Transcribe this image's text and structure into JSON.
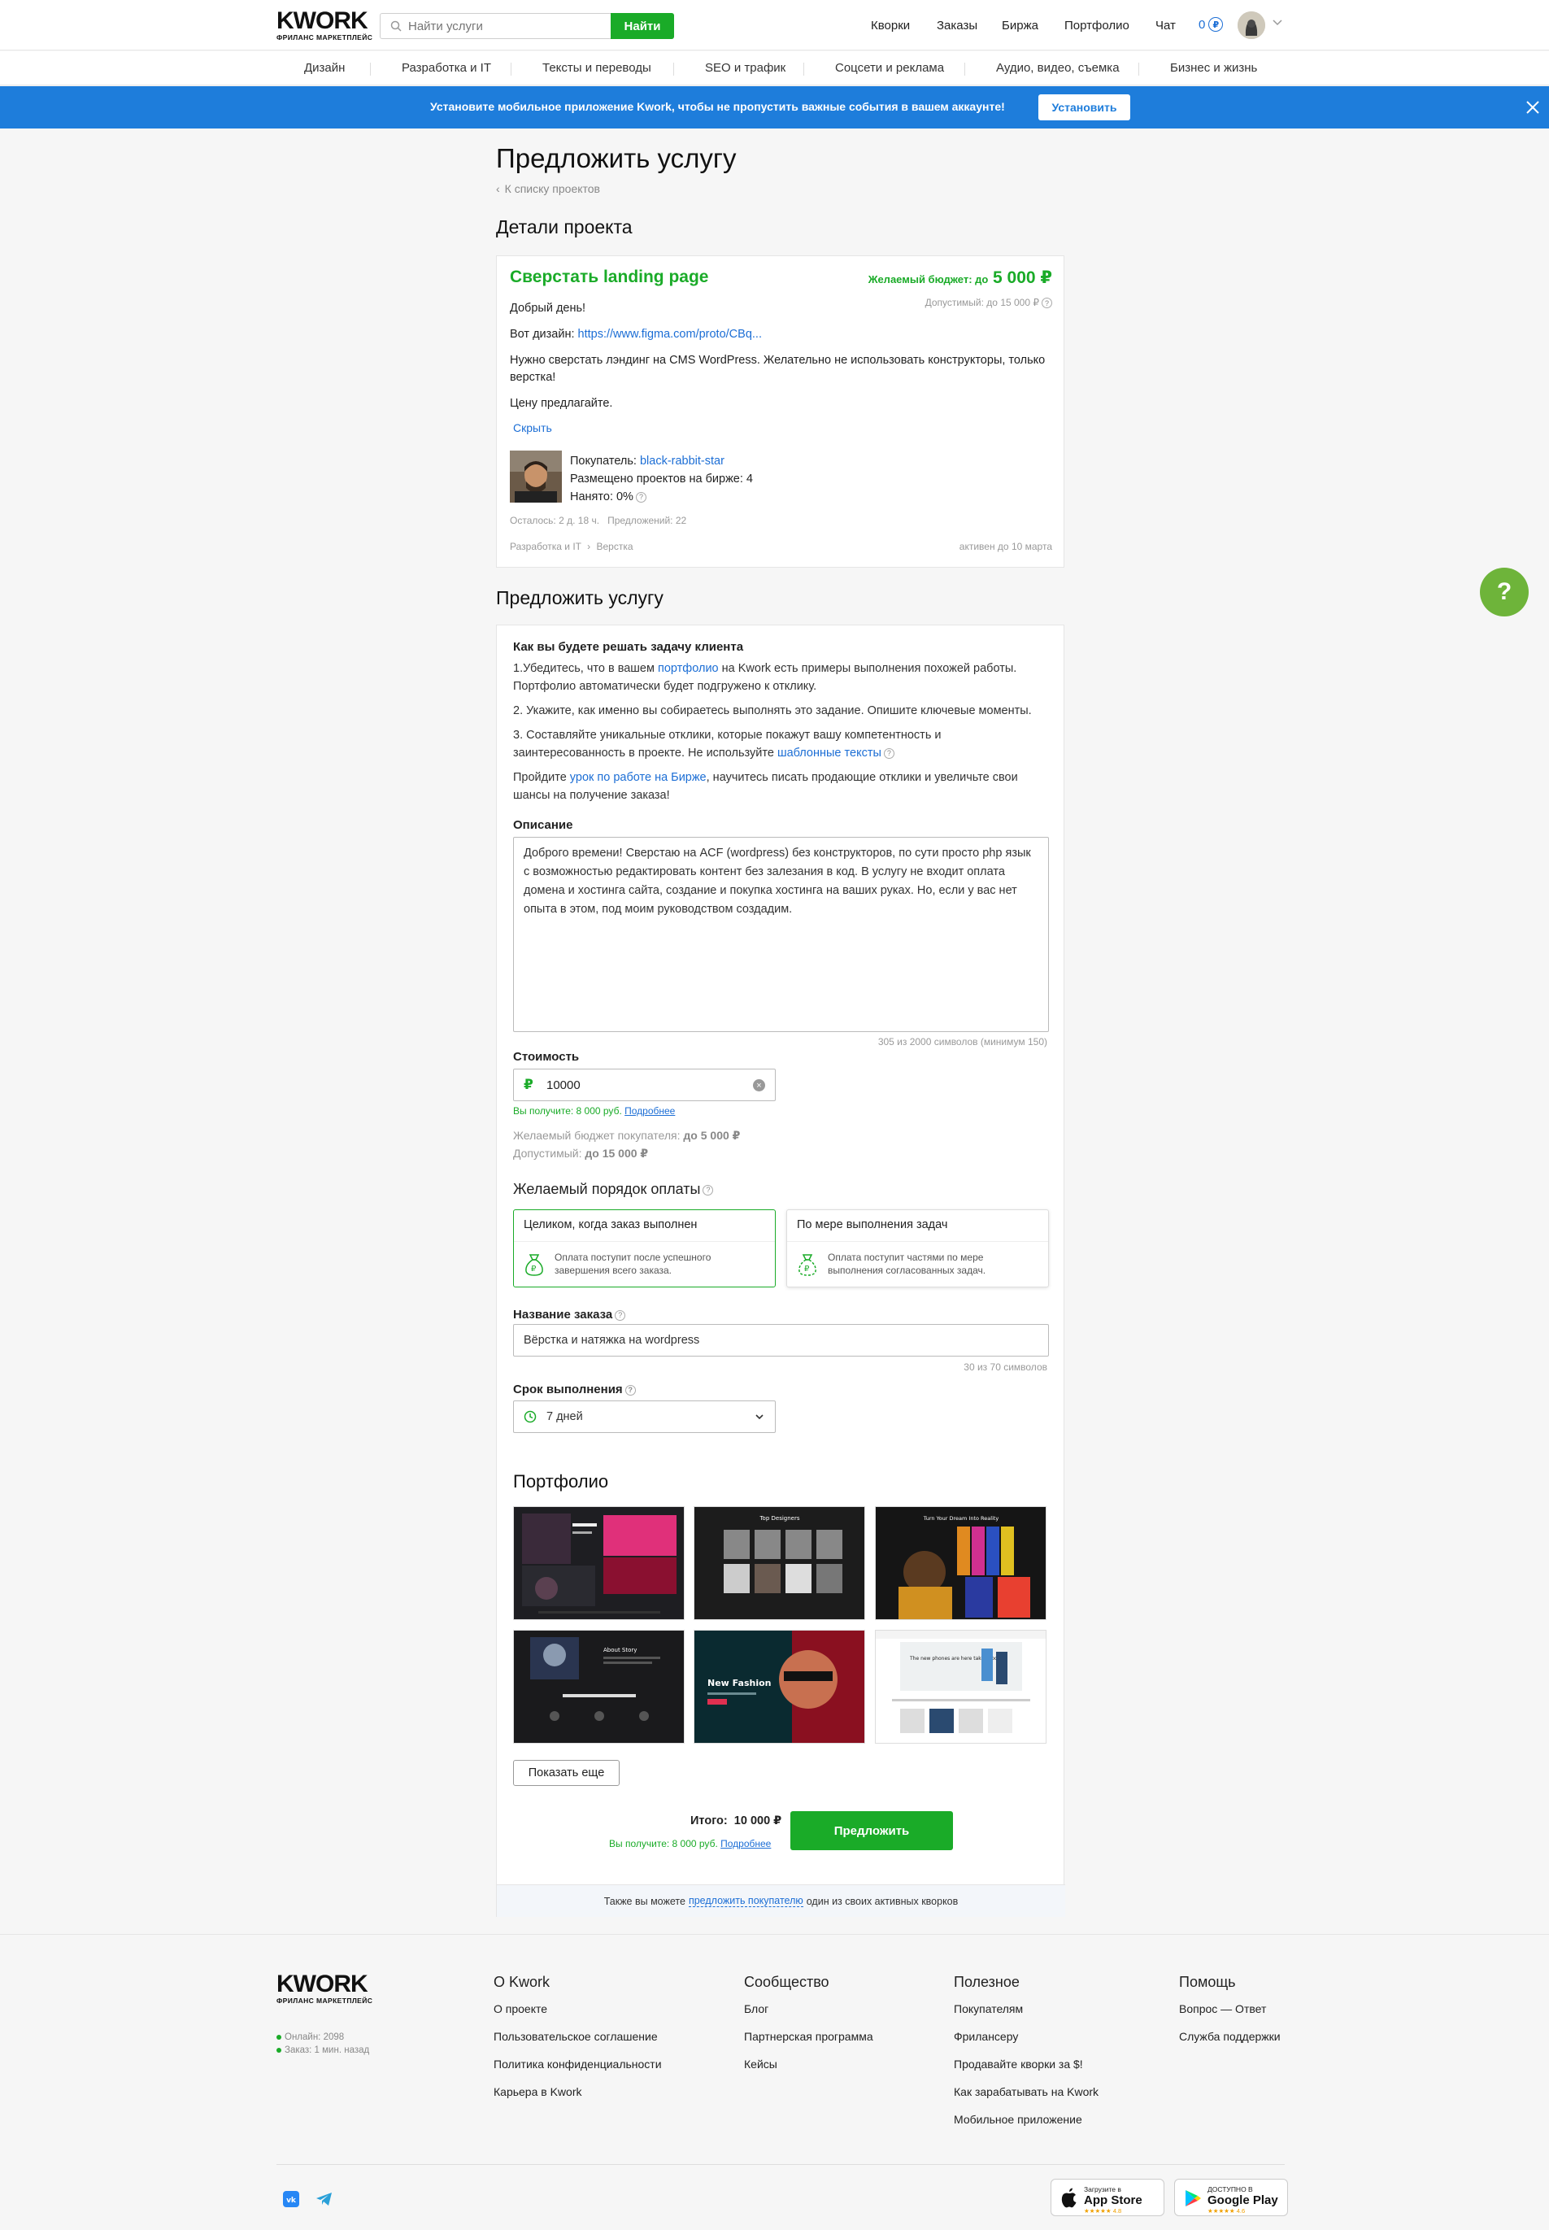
{
  "header": {
    "logo": "KWORK",
    "logo_sub": "ФРИЛАНС МАРКЕТПЛЕЙС",
    "search_placeholder": "Найти услуги",
    "search_btn": "Найти",
    "nav": [
      "Кворки",
      "Заказы",
      "Биржа",
      "Портфолио",
      "Чат"
    ],
    "balance": "0",
    "balance_icon": "₽"
  },
  "categories": [
    "Дизайн",
    "Разработка и IT",
    "Тексты и переводы",
    "SEO и трафик",
    "Соцсети и реклама",
    "Аудио, видео, съемка",
    "Бизнес и жизнь"
  ],
  "banner": {
    "text": "Установите мобильное приложение Kwork, чтобы не пропустить важные события в вашем аккаунте!",
    "button": "Установить"
  },
  "page": {
    "title": "Предложить услугу",
    "back": "К списку проектов",
    "details_heading": "Детали проекта",
    "offer_heading": "Предложить услугу"
  },
  "project": {
    "title": "Сверстать landing page",
    "budget_label": "Желаемый бюджет: до",
    "budget_value": "5 000 ₽",
    "allowed": "Допустимый: до 15 000 ₽",
    "p1": "Добрый день!",
    "p2_prefix": "Вот дизайн:",
    "p2_link": "https://www.figma.com/proto/CBq...",
    "p3": "Нужно сверстать лэндинг на CMS WordPress. Желательно не использовать конструкторы, только верстка!",
    "p4": "Цену предлагайте.",
    "hide": "Скрыть",
    "buyer_label": "Покупатель:",
    "buyer_name": "black-rabbit-star",
    "posted": "Размещено проектов на бирже: 4",
    "hired": "Нанято: 0%",
    "left": "Осталось: 2 д. 18 ч.",
    "offers": "Предложений: 22",
    "cat1": "Разработка и IT",
    "cat2": "Верстка",
    "active": "активен до 10 марта"
  },
  "offer": {
    "how_title": "Как вы будете решать задачу клиента",
    "s1_a": "1.Убедитесь, что в вашем",
    "s1_link": "портфолио",
    "s1_b": "на Kwork есть примеры выполнения похожей работы. Портфолио автоматически будет подгружено к отклику.",
    "s2": "2. Укажите, как именно вы собираетесь выполнять это задание. Опишите ключевые моменты.",
    "s3_a": "3. Составляйте уникальные отклики, которые покажут вашу компетентность и заинтересованность в проекте. Не используйте",
    "s3_link": "шаблонные тексты",
    "s4_a": "Пройдите",
    "s4_link": "урок по работе на Бирже",
    "s4_b": ", научитесь писать продающие отклики и увеличьте свои шансы на получение заказа!",
    "desc_label": "Описание",
    "desc_text": "Доброго времени! Сверстаю на ACF (wordpress) без конструкторов, по сути просто php язык с возможностью редактировать контент без залезания в код. В услугу не входит оплата домена и хостинга сайта, создание и покупка хостинга на ваших руках. Но, если у вас нет опыта в этом, под моим руководством создадим.",
    "desc_counter": "305 из 2000 символов (минимум 150)",
    "price_label": "Стоимость",
    "price_value": "10000",
    "price_currency": "₽",
    "receive": "Вы получите: 8 000 руб.",
    "more": "Подробнее",
    "buyer_budget_label": "Желаемый бюджет покупателя:",
    "buyer_budget_value": "до 5 000 ₽",
    "allowed_label": "Допустимый:",
    "allowed_value": "до 15 000 ₽",
    "pay_title": "Желаемый порядок оплаты",
    "pay1_title": "Целиком, когда заказ выполнен",
    "pay1_desc": "Оплата поступит после успешного завершения всего заказа.",
    "pay2_title": "По мере выполнения задач",
    "pay2_desc": "Оплата поступит частями по мере выполнения согласованных задач.",
    "name_label": "Название заказа",
    "name_value": "Вёрстка и натяжка на wordpress",
    "name_counter": "30 из 70 символов",
    "term_label": "Срок выполнения",
    "term_value": "7 дней",
    "portfolio_title": "Портфолио",
    "show_more": "Показать еще",
    "total_label": "Итого:",
    "total_value": "10 000 ₽",
    "total_receive": "Вы получите: 8 000 руб.",
    "total_more": "Подробнее",
    "submit": "Предложить",
    "foot_a": "Также вы можете",
    "foot_link": "предложить покупателю",
    "foot_b": "один из своих активных кворков"
  },
  "portfolio_thumbs": [
    {
      "caption": "",
      "bg": "#1e1e22",
      "accent": "#e0307a"
    },
    {
      "caption": "Top Designers",
      "bg": "#1c1c1c",
      "accent": "#8a7a6a"
    },
    {
      "caption": "Turn Your Dream Into Reality",
      "bg": "#151515",
      "accent": "#e08a20"
    },
    {
      "caption": "About Story",
      "bg": "#1a1a1c",
      "accent": "#3060c0"
    },
    {
      "caption": "New Fashion",
      "bg": "#0a2a30",
      "accent": "#e03050"
    },
    {
      "caption": "The new phones are here take a look",
      "bg": "#ffffff",
      "accent": "#4a8fd0"
    }
  ],
  "help_icon": "?",
  "footer": {
    "logo": "KWORK",
    "logo_sub": "ФРИЛАНС МАРКЕТПЛЕЙС",
    "online": "Онлайн: 2098",
    "order": "Заказ: 1 мин. назад",
    "cols": [
      {
        "title": "О Kwork",
        "items": [
          "О проекте",
          "Пользовательское соглашение",
          "Политика конфиденциальности",
          "Карьера в Kwork"
        ]
      },
      {
        "title": "Сообщество",
        "items": [
          "Блог",
          "Партнерская программа",
          "Кейсы"
        ]
      },
      {
        "title": "Полезное",
        "items": [
          "Покупателям",
          "Фрилансеру",
          "Продавайте кворки за $!",
          "Как зарабатывать на Kwork",
          "Мобильное приложение"
        ]
      },
      {
        "title": "Помощь",
        "items": [
          "Вопрос — Ответ",
          "Служба поддержки"
        ]
      }
    ],
    "appstore_small": "Загрузите в",
    "appstore_big": "App Store",
    "appstore_rating": "★★★★★ 4.8",
    "gplay_small": "ДОСТУПНО В",
    "gplay_big": "Google Play",
    "gplay_rating": "★★★★★ 4.6"
  },
  "colors": {
    "green": "#1aab28",
    "blue": "#1c6ed5",
    "banner": "#1e7ddb",
    "help": "#6eb43a"
  }
}
